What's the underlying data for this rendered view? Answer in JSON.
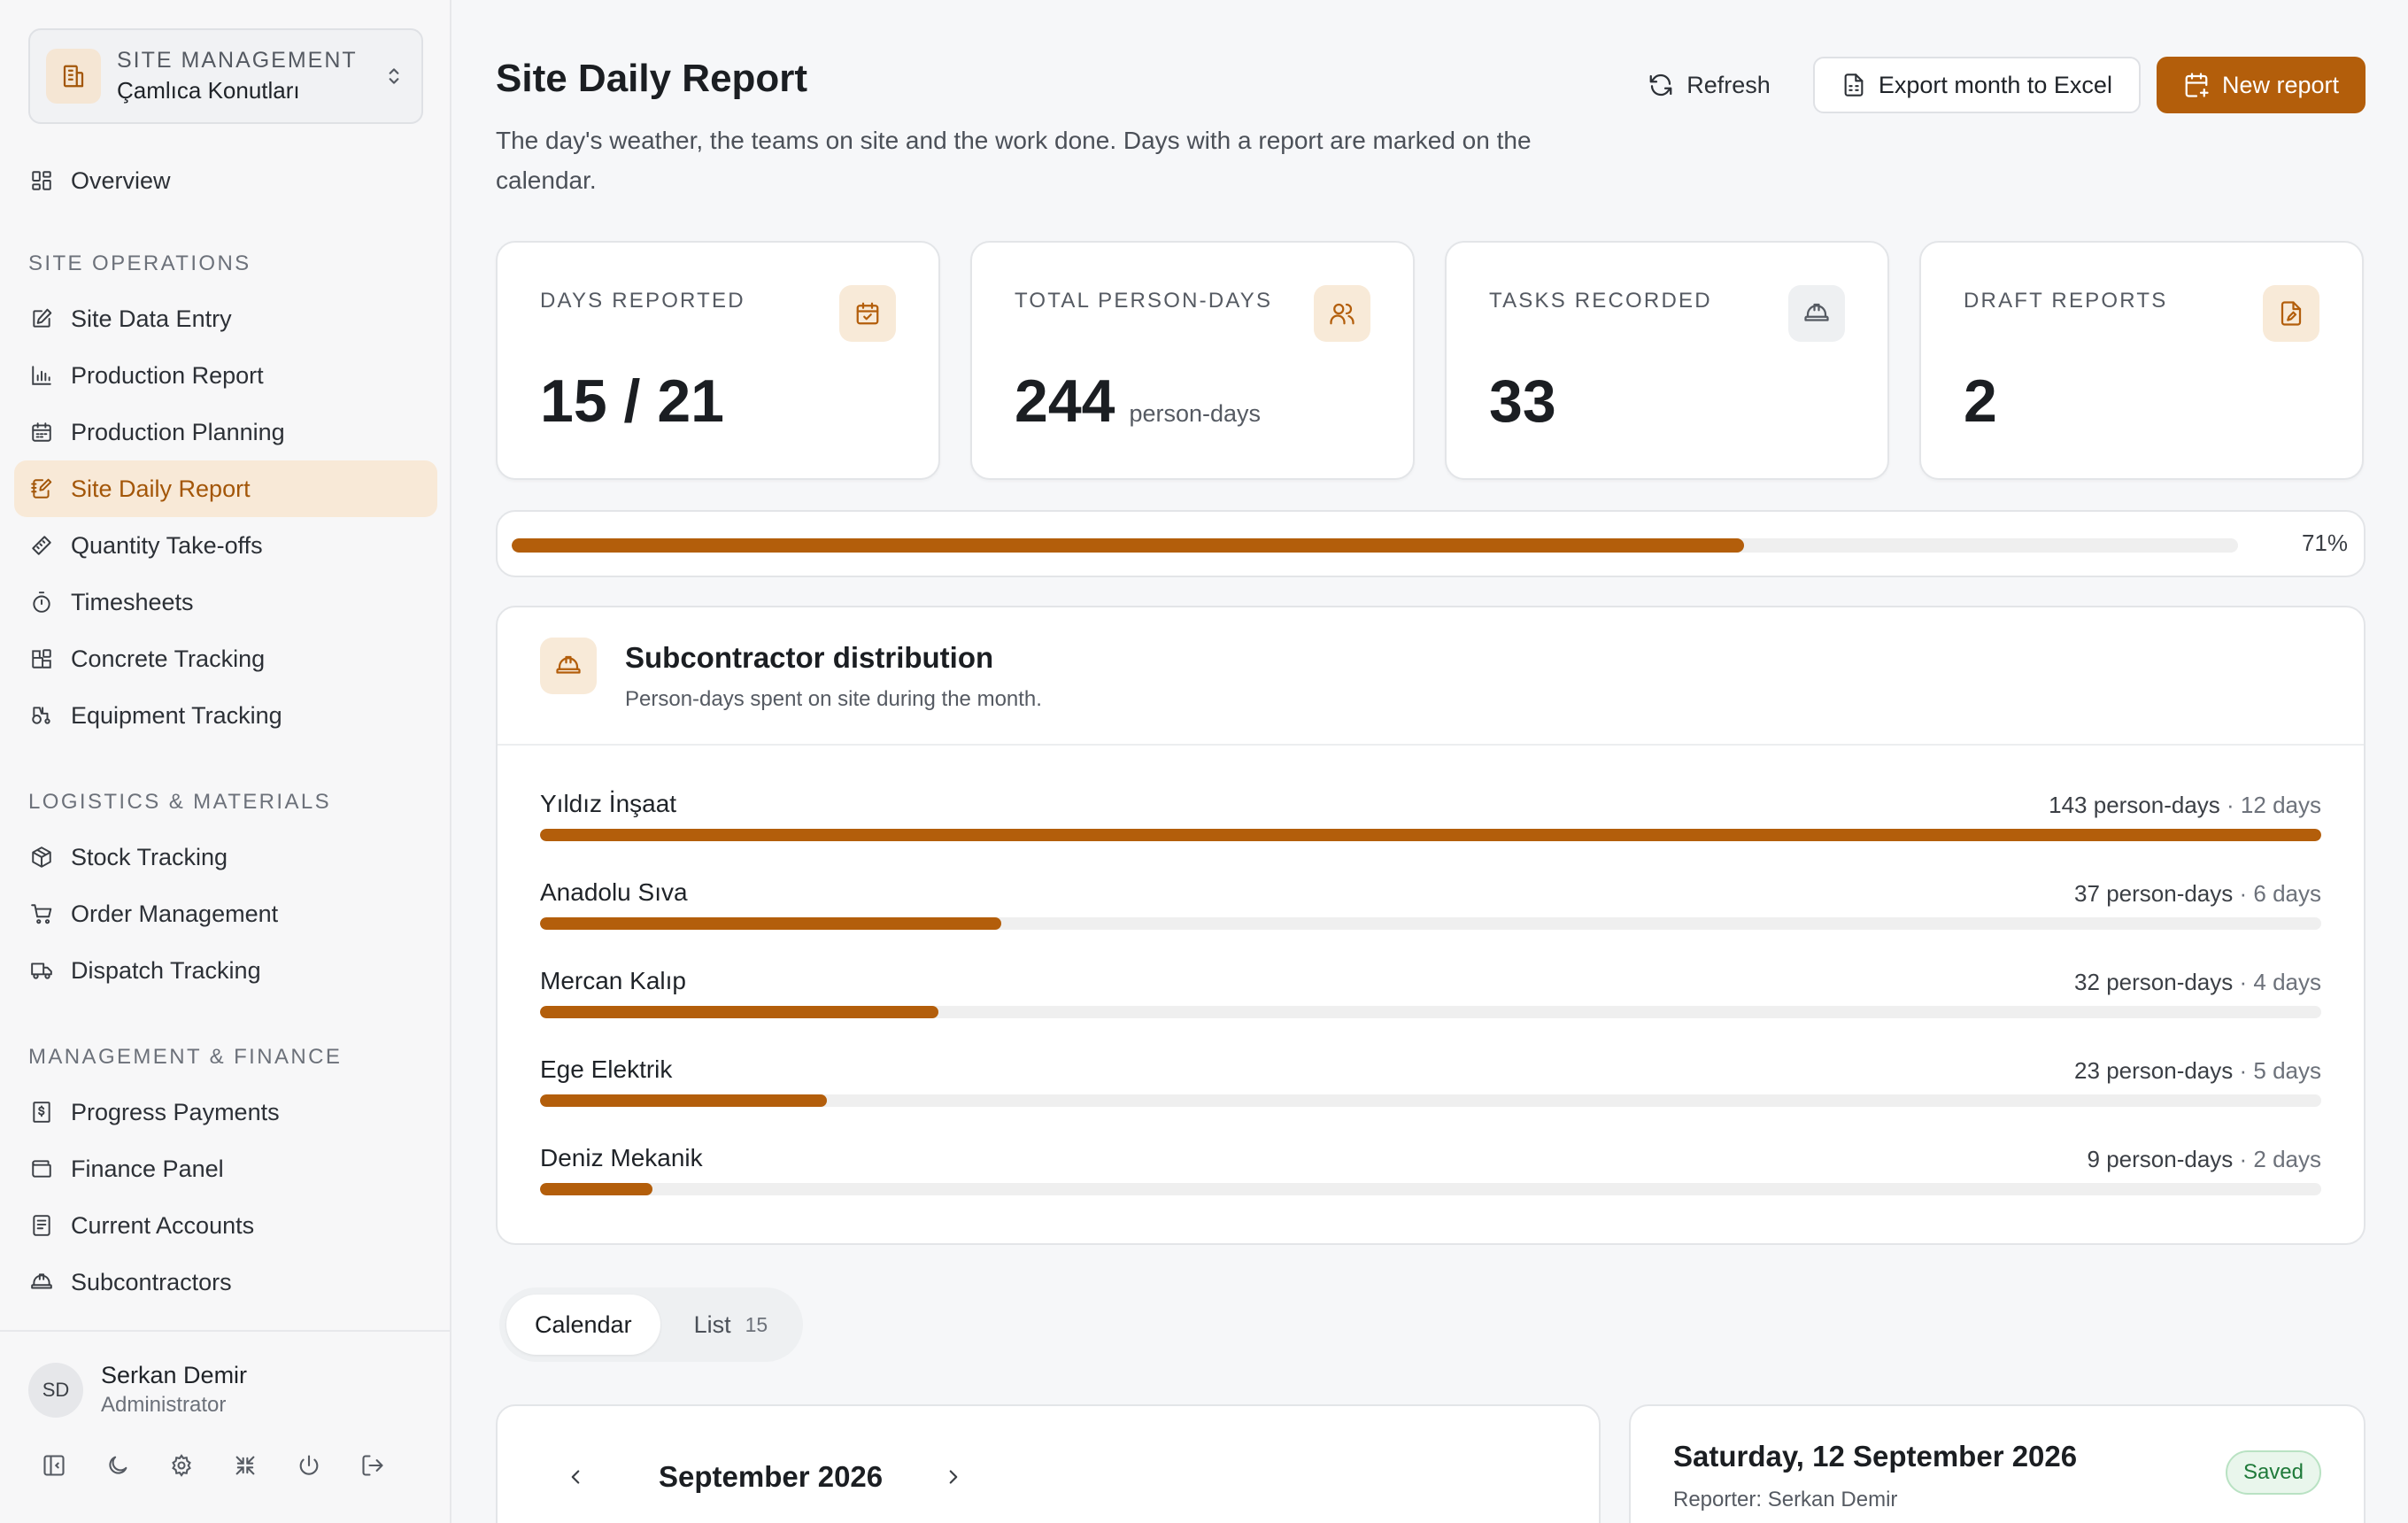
{
  "site_switcher": {
    "kicker": "SITE MANAGEMENT",
    "name": "Çamlıca Konutları"
  },
  "nav_top": [
    {
      "label": "Overview",
      "icon": "layout-grid-icon"
    }
  ],
  "sections": {
    "site_operations": "SITE OPERATIONS",
    "logistics": "LOGISTICS & MATERIALS",
    "management": "MANAGEMENT & FINANCE"
  },
  "nav_site": [
    {
      "label": "Site Data Entry",
      "icon": "edit-icon"
    },
    {
      "label": "Production Report",
      "icon": "bar-chart-icon"
    },
    {
      "label": "Production Planning",
      "icon": "calendar-icon"
    },
    {
      "label": "Site Daily Report",
      "icon": "notebook-pen-icon",
      "active": true
    },
    {
      "label": "Quantity Take-offs",
      "icon": "ruler-icon"
    },
    {
      "label": "Timesheets",
      "icon": "stopwatch-icon"
    },
    {
      "label": "Concrete Tracking",
      "icon": "blocks-icon"
    },
    {
      "label": "Equipment Tracking",
      "icon": "tractor-icon"
    }
  ],
  "nav_logistics": [
    {
      "label": "Stock Tracking",
      "icon": "package-icon"
    },
    {
      "label": "Order Management",
      "icon": "cart-icon"
    },
    {
      "label": "Dispatch Tracking",
      "icon": "truck-icon"
    }
  ],
  "nav_management": [
    {
      "label": "Progress Payments",
      "icon": "receipt-dollar-icon"
    },
    {
      "label": "Finance Panel",
      "icon": "wallet-icon"
    },
    {
      "label": "Current Accounts",
      "icon": "ledger-icon"
    },
    {
      "label": "Subcontractors",
      "icon": "hard-hat-icon"
    }
  ],
  "user": {
    "initials": "SD",
    "name": "Serkan Demir",
    "role": "Administrator"
  },
  "header": {
    "title": "Site Daily Report",
    "description": "The day's weather, the teams on site and the work done. Days with a report are marked on the calendar.",
    "refresh_label": "Refresh",
    "export_label": "Export month to Excel",
    "new_report_label": "New report"
  },
  "stats": [
    {
      "label": "DAYS REPORTED",
      "value": "15 / 21",
      "unit": "",
      "icon": "calendar-check-icon"
    },
    {
      "label": "TOTAL PERSON-DAYS",
      "value": "244",
      "unit": "person-days",
      "icon": "users-icon"
    },
    {
      "label": "TASKS RECORDED",
      "value": "33",
      "unit": "",
      "icon": "hard-hat-icon"
    },
    {
      "label": "DRAFT REPORTS",
      "value": "2",
      "unit": "",
      "icon": "file-pen-icon"
    }
  ],
  "progress": {
    "percent_label": "71%",
    "fraction": 0.714
  },
  "subcontractors": {
    "title": "Subcontractor distribution",
    "subtitle": "Person-days spent on site during the month.",
    "rows": [
      {
        "name": "Yıldız İnşaat",
        "person_days": "143 person-days",
        "days": "12 days",
        "value": 143
      },
      {
        "name": "Anadolu Sıva",
        "person_days": "37 person-days",
        "days": "6 days",
        "value": 37
      },
      {
        "name": "Mercan Kalıp",
        "person_days": "32 person-days",
        "days": "4 days",
        "value": 32
      },
      {
        "name": "Ege Elektrik",
        "person_days": "23 person-days",
        "days": "5 days",
        "value": 23
      },
      {
        "name": "Deniz Mekanik",
        "person_days": "9 person-days",
        "days": "2 days",
        "value": 9
      }
    ]
  },
  "tabs": {
    "calendar": "Calendar",
    "list": "List",
    "list_count": "15"
  },
  "calendar": {
    "month": "September 2026"
  },
  "detail": {
    "title": "Saturday, 12 September 2026",
    "reporter": "Reporter: Serkan Demir",
    "status": "Saved"
  },
  "colors": {
    "accent": "#b35e0b",
    "accent_soft": "#f8e9d7",
    "success": "#1f7a3a"
  }
}
